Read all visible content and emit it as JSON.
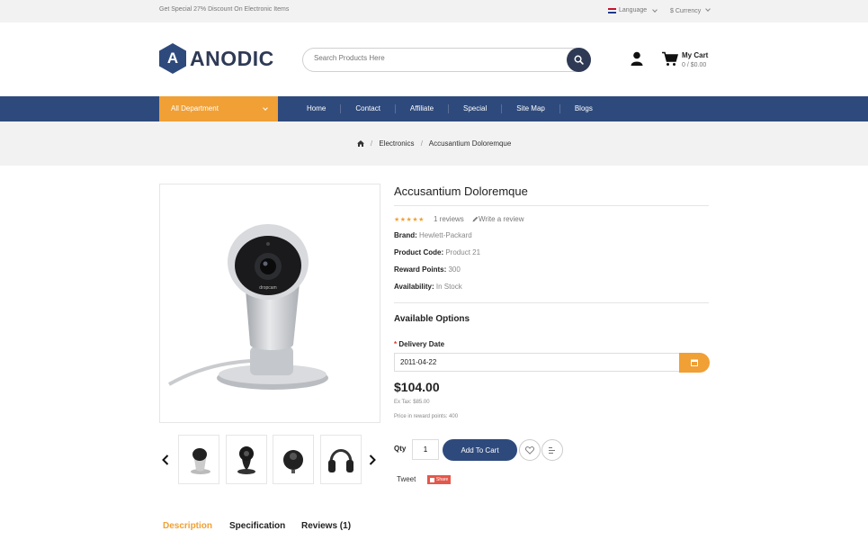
{
  "topbar": {
    "promo": "Get Special 27% Discount On Electronic Items",
    "language": "Language",
    "currency": "$ Currency"
  },
  "header": {
    "logo_text": "ANODIC",
    "search_placeholder": "Search Products Here",
    "cart_title": "My Cart",
    "cart_total": "0 / $0.00"
  },
  "nav": {
    "department": "All Department",
    "items": [
      "Home",
      "Contact",
      "Affiliate",
      "Special",
      "Site Map",
      "Blogs"
    ]
  },
  "breadcrumb": {
    "items": [
      "Electronics",
      "Accusantium Doloremque"
    ]
  },
  "product": {
    "title": "Accusantium Doloremque",
    "rating": 5,
    "stars": "★★★★★",
    "reviews": "1 reviews",
    "write_review": "Write a review",
    "brand_label": "Brand:",
    "brand_value": "Hewlett-Packard",
    "code_label": "Product Code:",
    "code_value": "Product 21",
    "points_label": "Reward Points:",
    "points_value": "300",
    "avail_label": "Availability:",
    "avail_value": "In Stock",
    "options_title": "Available Options",
    "delivery_label": "Delivery Date",
    "delivery_value": "2011-04-22",
    "price": "$104.00",
    "ex_tax": "Ex Tax: $85.00",
    "reward_price": "Price in reward points: 400",
    "qty_label": "Qty",
    "qty_value": "1",
    "add_to_cart": "Add To Cart",
    "tweet": "Tweet",
    "share": "Share",
    "image_brand": "dropcam"
  },
  "tabs": [
    "Description",
    "Specification",
    "Reviews (1)"
  ],
  "colors": {
    "primary": "#2e4a7d",
    "accent": "#f0a035",
    "dark": "#2e3a55"
  }
}
